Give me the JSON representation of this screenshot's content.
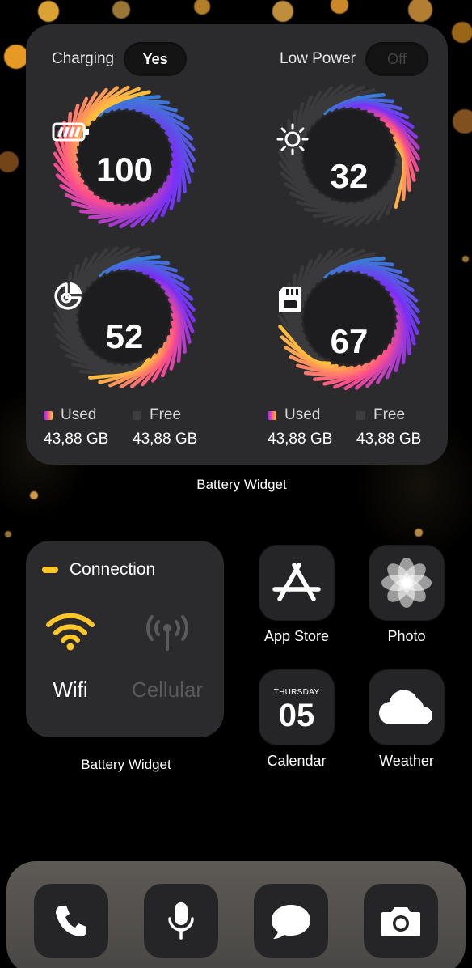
{
  "battery_widget": {
    "charging": {
      "label": "Charging",
      "value": "Yes"
    },
    "low_power": {
      "label": "Low Power",
      "value": "Off"
    },
    "gauges": {
      "battery": {
        "value": "100",
        "level": 1.0,
        "icon": "battery-icon"
      },
      "brightness": {
        "value": "32",
        "level": 0.32,
        "icon": "sun-icon"
      },
      "memory": {
        "value": "52",
        "level": 0.52,
        "icon": "pie-chart-icon"
      },
      "storage": {
        "value": "67",
        "level": 0.67,
        "icon": "sd-card-icon"
      }
    },
    "legend_left": {
      "used_label": "Used",
      "used_value": "43,88 GB",
      "free_label": "Free",
      "free_value": "43,88 GB"
    },
    "legend_right": {
      "used_label": "Used",
      "used_value": "43,88 GB",
      "free_label": "Free",
      "free_value": "43,88 GB"
    },
    "caption": "Battery Widget"
  },
  "connection_widget": {
    "title": "Connection",
    "wifi_label": "Wifi",
    "cellular_label": "Cellular",
    "caption": "Battery Widget"
  },
  "apps": {
    "app_store": "App Store",
    "photo": "Photo",
    "calendar": {
      "label": "Calendar",
      "day": "THURSDAY",
      "date": "05"
    },
    "weather": "Weather"
  },
  "dock": [
    "phone-icon",
    "microphone-icon",
    "messages-icon",
    "camera-icon"
  ],
  "colors": {
    "accent_yellow": "#ffc629",
    "widget_bg": "#2b2b2d",
    "ring_start": "#3a7bd5",
    "ring_end": "#ffc837"
  }
}
